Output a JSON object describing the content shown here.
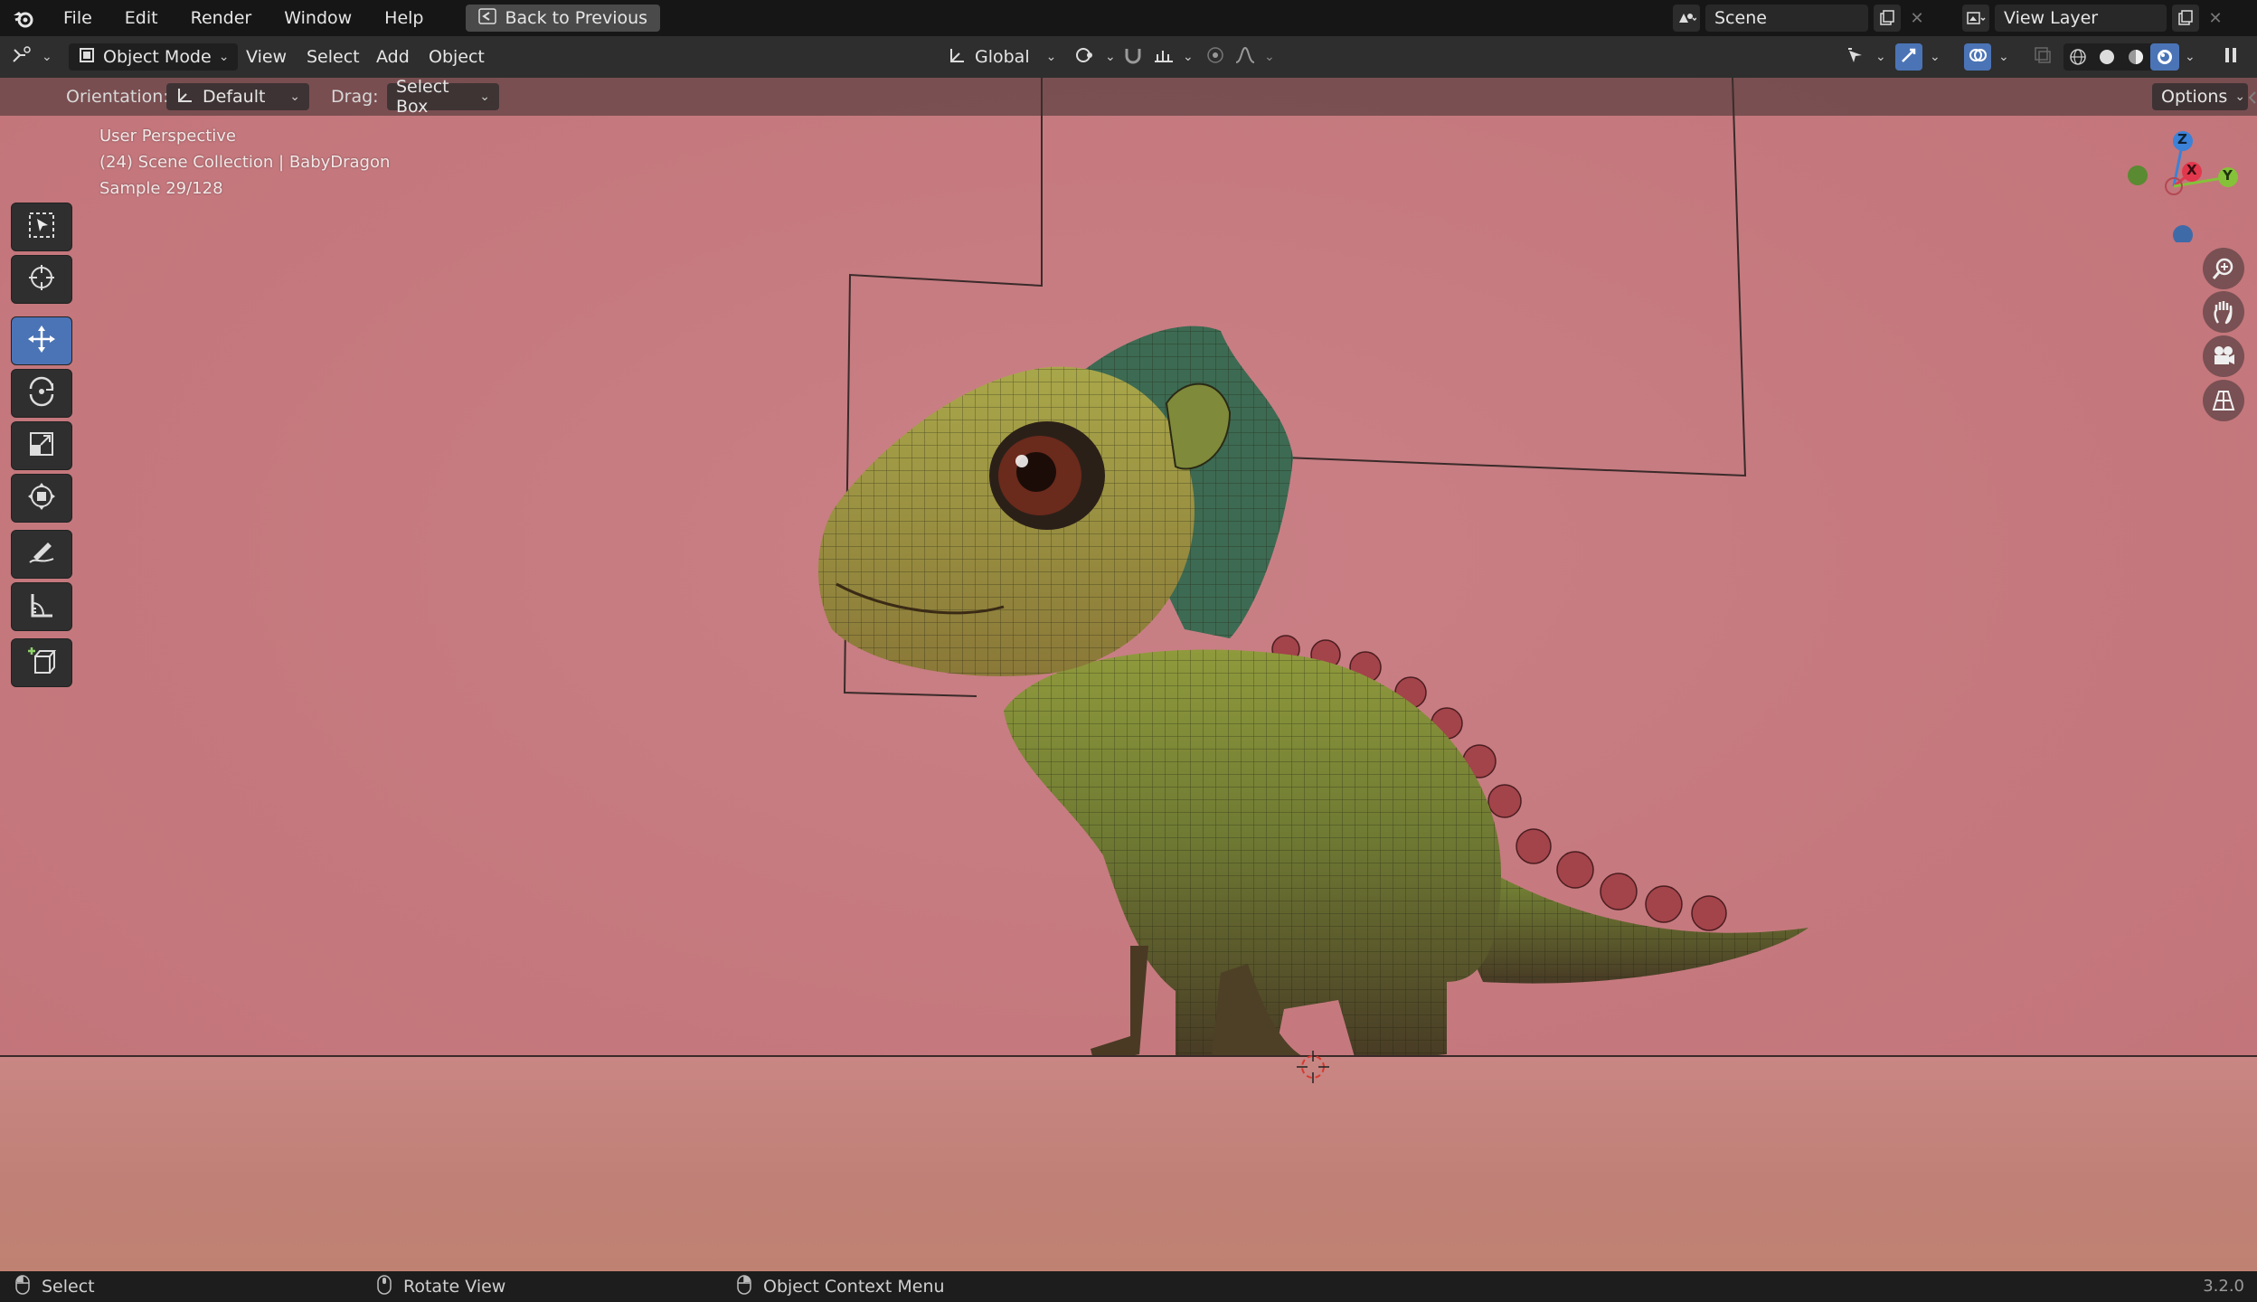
{
  "topbar": {
    "menus": [
      "File",
      "Edit",
      "Render",
      "Window",
      "Help"
    ],
    "back_button": "Back to Previous",
    "scene_name": "Scene",
    "view_layer_name": "View Layer"
  },
  "header": {
    "mode": "Object Mode",
    "menus": [
      "View",
      "Select",
      "Add",
      "Object"
    ],
    "transform_orientation": "Global"
  },
  "tool_settings": {
    "orientation_label": "Orientation:",
    "orientation_value": "Default",
    "drag_label": "Drag:",
    "drag_value": "Select Box",
    "options_label": "Options"
  },
  "viewport": {
    "view_name": "User Perspective",
    "collection_info": "(24) Scene Collection | BabyDragon",
    "sample_info": "Sample 29/128",
    "gizmo": {
      "z": "Z",
      "x": "X",
      "y": "Y"
    },
    "colors": {
      "background": "#c57c80",
      "active_tool": "#4b74b6",
      "axis_x": "#e2384d",
      "axis_y": "#85c239",
      "axis_z": "#3b82d8"
    }
  },
  "tools": [
    "select-box",
    "cursor",
    "move",
    "rotate",
    "scale",
    "transform",
    "annotate",
    "measure",
    "add-cube"
  ],
  "statusbar": {
    "select": "Select",
    "rotate_view": "Rotate View",
    "context_menu": "Object Context Menu",
    "version": "3.2.0"
  }
}
